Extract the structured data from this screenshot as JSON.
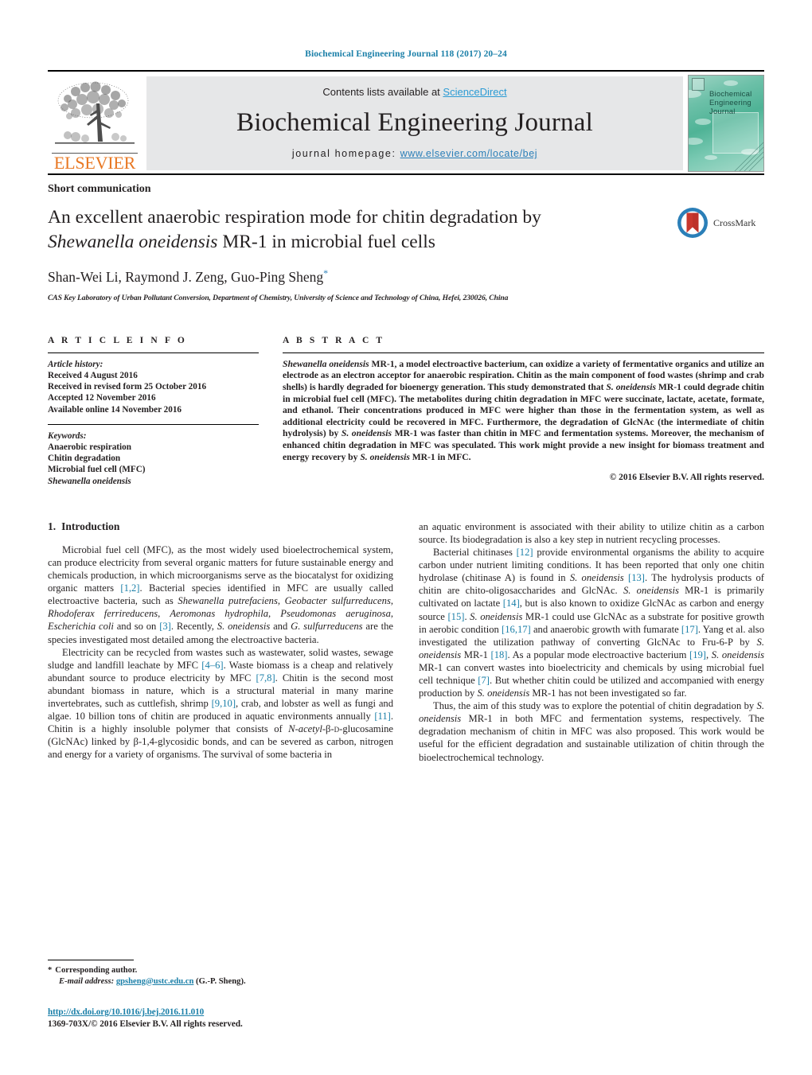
{
  "running_head": "Biochemical Engineering Journal 118 (2017) 20–24",
  "masthead": {
    "publisher_name": "ELSEVIER",
    "contents_prefix": "Contents lists available at ",
    "contents_link": "ScienceDirect",
    "journal_name": "Biochemical Engineering Journal",
    "homepage_label": "journal homepage:",
    "homepage_url": "www.elsevier.com/locate/bej",
    "cover_title_line1": "Biochemical",
    "cover_title_line2": "Engineering",
    "cover_title_line3": "Journal"
  },
  "article": {
    "type": "Short communication",
    "title_line1": "An excellent anaerobic respiration mode for chitin degradation by",
    "title_italic": "Shewanella oneidensis",
    "title_line2_rest": " MR-1 in microbial fuel cells",
    "authors": "Shan-Wei Li, Raymond J. Zeng, Guo-Ping Sheng",
    "author_star": "*",
    "affiliation": "CAS Key Laboratory of Urban Pollutant Conversion, Department of Chemistry, University of Science and Technology of China, Hefei, 230026, China",
    "crossmark_label": "CrossMark"
  },
  "article_info": {
    "heading": "A R T I C L E   I N F O",
    "history_label": "Article history:",
    "history": [
      "Received 4 August 2016",
      "Received in revised form 25 October 2016",
      "Accepted 12 November 2016",
      "Available online 14 November 2016"
    ],
    "keywords_label": "Keywords:",
    "keywords": [
      "Anaerobic respiration",
      "Chitin degradation",
      "Microbial fuel cell (MFC)",
      "Shewanella oneidensis"
    ]
  },
  "abstract": {
    "heading": "A B S T R A C T",
    "lead_italic": "Shewanella oneidensis",
    "text": " MR-1, a model electroactive bacterium, can oxidize a variety of fermentative organics and utilize an electrode as an electron acceptor for anaerobic respiration. Chitin as the main component of food wastes (shrimp and crab shells) is hardly degraded for bioenergy generation. This study demonstrated that S. oneidensis MR-1 could degrade chitin in microbial fuel cell (MFC). The metabolites during chitin degradation in MFC were succinate, lactate, acetate, formate, and ethanol. Their concentrations produced in MFC were higher than those in the fermentation system, as well as additional electricity could be recovered in MFC. Furthermore, the degradation of GlcNAc (the intermediate of chitin hydrolysis) by S. oneidensis MR-1 was faster than chitin in MFC and fermentation systems. Moreover, the mechanism of enhanced chitin degradation in MFC was speculated. This work might provide a new insight for biomass treatment and energy recovery by S. oneidensis MR-1 in MFC.",
    "copyright": "© 2016 Elsevier B.V. All rights reserved."
  },
  "body": {
    "section_number": "1.",
    "section_title": "Introduction",
    "left_paragraphs": [
      "Microbial fuel cell (MFC), as the most widely used bioelectrochemical system, can produce electricity from several organic matters for future sustainable energy and chemicals production, in which microorganisms serve as the biocatalyst for oxidizing organic matters [1,2]. Bacterial species identified in MFC are usually called electroactive bacteria, such as Shewanella putrefaciens, Geobacter sulfurreducens, Rhodoferax ferrireducens, Aeromonas hydrophila, Pseudomonas aeruginosa, Escherichia coli and so on [3]. Recently, S. oneidensis and G. sulfurreducens are the species investigated most detailed among the electroactive bacteria.",
      "Electricity can be recycled from wastes such as wastewater, solid wastes, sewage sludge and landfill leachate by MFC [4–6]. Waste biomass is a cheap and relatively abundant source to produce electricity by MFC [7,8]. Chitin is the second most abundant biomass in nature, which is a structural material in many marine invertebrates, such as cuttlefish, shrimp [9,10], crab, and lobster as well as fungi and algae. 10 billion tons of chitin are produced in aquatic environments annually [11]. Chitin is a highly insoluble polymer that consists of N-acetyl-β-D-glucosamine (GlcNAc) linked by β-1,4-glycosidic bonds, and can be severed as carbon, nitrogen and energy for a variety of organisms. The survival of some bacteria in"
    ],
    "right_paragraphs": [
      "an aquatic environment is associated with their ability to utilize chitin as a carbon source. Its biodegradation is also a key step in nutrient recycling processes.",
      "Bacterial chitinases [12] provide environmental organisms the ability to acquire carbon under nutrient limiting conditions. It has been reported that only one chitin hydrolase (chitinase A) is found in S. oneidensis [13]. The hydrolysis products of chitin are chito-oligosaccharides and GlcNAc. S. oneidensis MR-1 is primarily cultivated on lactate [14], but is also known to oxidize GlcNAc as carbon and energy source [15]. S. oneidensis MR-1 could use GlcNAc as a substrate for positive growth in aerobic condition [16,17] and anaerobic growth with fumarate [17]. Yang et al. also investigated the utilization pathway of converting GlcNAc to Fru-6-P by S. oneidensis MR-1 [18]. As a popular mode electroactive bacterium [19], S. oneidensis MR-1 can convert wastes into bioelectricity and chemicals by using microbial fuel cell technique [7]. But whether chitin could be utilized and accompanied with energy production by S. oneidensis MR-1 has not been investigated so far.",
      "Thus, the aim of this study was to explore the potential of chitin degradation by S. oneidensis MR-1 in both MFC and fermentation systems, respectively. The degradation mechanism of chitin in MFC was also proposed. This work would be useful for the efficient degradation and sustainable utilization of chitin through the bioelectrochemical technology."
    ]
  },
  "footer": {
    "corresponding_star": "*",
    "corresponding_label": "Corresponding author.",
    "email_label": "E-mail address:",
    "email": "gpsheng@ustc.edu.cn",
    "email_suffix": " (G.-P. Sheng).",
    "doi": "http://dx.doi.org/10.1016/j.bej.2016.11.010",
    "issn_line": "1369-703X/© 2016 Elsevier B.V. All rights reserved."
  },
  "colors": {
    "link": "#1a7fa8",
    "sciencedirect": "#2b9bd4",
    "elsevier_orange": "#E87722",
    "band_gray": "#e6e7e8"
  }
}
